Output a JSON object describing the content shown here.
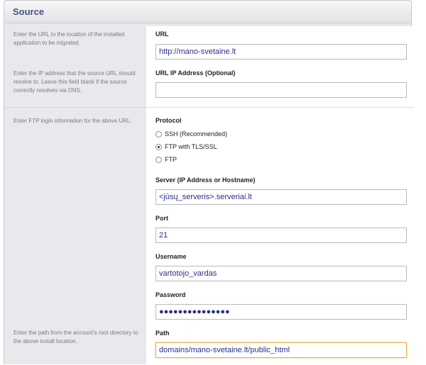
{
  "section": {
    "title": "Source"
  },
  "help": {
    "url": "Enter the URL to the location of the installed application to be migrated.",
    "ip": "Enter the IP address that the source URL should resolve to. Leave this field blank if the source correctly resolves via DNS.",
    "ftp": "Enter FTP login information for the above URL.",
    "path": "Enter the path from the account's root directory to the above install location."
  },
  "fields": {
    "url": {
      "label": "URL",
      "value": "http://mano-svetaine.lt"
    },
    "ip": {
      "label": "URL IP Address (Optional)",
      "value": ""
    },
    "protocol": {
      "label": "Protocol",
      "options": [
        "SSH (Recommended)",
        "FTP with TLS/SSL",
        "FTP"
      ],
      "selected": "FTP with TLS/SSL"
    },
    "server": {
      "label": "Server (IP Address or Hostname)",
      "value": "<jūsų_serveris>.serveriai.lt"
    },
    "port": {
      "label": "Port",
      "value": "21"
    },
    "username": {
      "label": "Username",
      "value": "vartotojo_vardas"
    },
    "password": {
      "label": "Password",
      "value": "●●●●●●●●●●●●●●●"
    },
    "path": {
      "label": "Path",
      "value": "domains/mano-svetaine.lt/public_html"
    }
  }
}
